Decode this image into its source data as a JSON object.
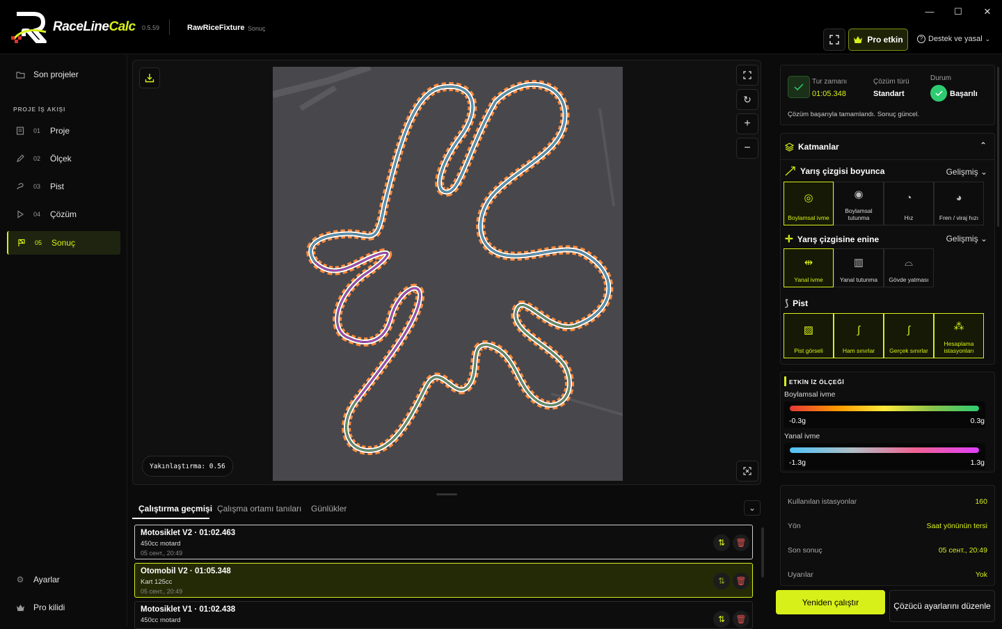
{
  "app": {
    "brand_a": "RaceLine",
    "brand_b": "Calc",
    "version": "0.5.59",
    "fixture": "RawRiceFixture",
    "crumb": "Sonuç",
    "pro_label": "Pro etkin",
    "support_label": "Destek ve yasal"
  },
  "sidebar": {
    "recent": "Son projeler",
    "section": "PROJE İŞ AKIŞI",
    "items": [
      {
        "num": "01",
        "label": "Proje"
      },
      {
        "num": "02",
        "label": "Ölçek"
      },
      {
        "num": "03",
        "label": "Pist"
      },
      {
        "num": "04",
        "label": "Çözüm"
      },
      {
        "num": "05",
        "label": "Sonuç"
      }
    ],
    "settings": "Ayarlar",
    "pro_lock": "Pro kilidi"
  },
  "viewer": {
    "zoom_label": "Yakınlaştırma: 0.56"
  },
  "bottom": {
    "tabs": [
      "Çalıştırma geçmişi",
      "Çalışma ortamı tanıları",
      "Günlükler"
    ],
    "runs": [
      {
        "title": "Motosiklet V2 · 01:02.463",
        "desc": "450cc motard",
        "date": "05 сент., 20:49"
      },
      {
        "title": "Otomobil V2 · 01:05.348",
        "desc": "Kart 125cc",
        "date": "05 сент., 20:49"
      },
      {
        "title": "Motosiklet V1 · 01:02.438",
        "desc": "450cc motard",
        "date": ""
      }
    ]
  },
  "summary": {
    "lap_label": "Tur zamanı",
    "lap_value": "01:05.348",
    "type_label": "Çözüm türü",
    "type_value": "Standart",
    "status_label": "Durum",
    "status_value": "Başarılı",
    "message": "Çözüm başarıyla tamamlandı. Sonuç güncel."
  },
  "layers": {
    "title": "Katmanlar",
    "along_title": "Yarış çizgisi boyunca",
    "advanced": "Gelişmiş",
    "along_tiles": [
      "Boylamsal ivme",
      "Boylamsal tutunma",
      "Hız",
      "Fren / viraj hızı"
    ],
    "lateral_title": "Yarış çizgisine enine",
    "lateral_tiles": [
      "Yanal ivme",
      "Yanal tutunma",
      "Gövde yatması"
    ],
    "track_title": "Pist",
    "track_tiles": [
      "Pist görseli",
      "Ham sınırlar",
      "Gerçek sınırlar",
      "Hesaplama istasyonları"
    ]
  },
  "scale": {
    "title": "ETKİN İZ ÖLÇEĞİ",
    "long_label": "Boylamsal ivme",
    "long_min": "-0.3g",
    "long_max": "0.3g",
    "lat_label": "Yanal ivme",
    "lat_min": "-1.3g",
    "lat_max": "1.3g"
  },
  "stats": [
    {
      "k": "Kullanılan istasyonlar",
      "v": "160"
    },
    {
      "k": "Yön",
      "v": "Saat yönünün tersi"
    },
    {
      "k": "Son sonuç",
      "v": "05 сент., 20:49"
    },
    {
      "k": "Uyarılar",
      "v": "Yok"
    }
  ],
  "actions": {
    "rerun": "Yeniden çalıştır",
    "edit": "Çözücü ayarlarını düzenle"
  },
  "colors": {
    "accent": "#d8f01a",
    "success": "#2ecc71"
  }
}
